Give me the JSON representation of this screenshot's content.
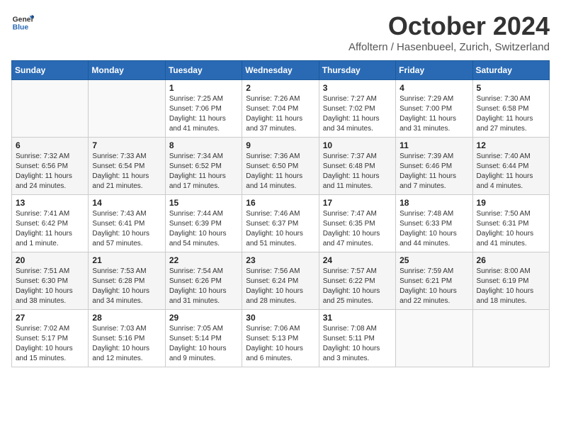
{
  "header": {
    "logo_general": "General",
    "logo_blue": "Blue",
    "title": "October 2024",
    "subtitle": "Affoltern / Hasenbueel, Zurich, Switzerland"
  },
  "weekdays": [
    "Sunday",
    "Monday",
    "Tuesday",
    "Wednesday",
    "Thursday",
    "Friday",
    "Saturday"
  ],
  "weeks": [
    [
      {
        "day": "",
        "sunrise": "",
        "sunset": "",
        "daylight": ""
      },
      {
        "day": "",
        "sunrise": "",
        "sunset": "",
        "daylight": ""
      },
      {
        "day": "1",
        "sunrise": "Sunrise: 7:25 AM",
        "sunset": "Sunset: 7:06 PM",
        "daylight": "Daylight: 11 hours and 41 minutes."
      },
      {
        "day": "2",
        "sunrise": "Sunrise: 7:26 AM",
        "sunset": "Sunset: 7:04 PM",
        "daylight": "Daylight: 11 hours and 37 minutes."
      },
      {
        "day": "3",
        "sunrise": "Sunrise: 7:27 AM",
        "sunset": "Sunset: 7:02 PM",
        "daylight": "Daylight: 11 hours and 34 minutes."
      },
      {
        "day": "4",
        "sunrise": "Sunrise: 7:29 AM",
        "sunset": "Sunset: 7:00 PM",
        "daylight": "Daylight: 11 hours and 31 minutes."
      },
      {
        "day": "5",
        "sunrise": "Sunrise: 7:30 AM",
        "sunset": "Sunset: 6:58 PM",
        "daylight": "Daylight: 11 hours and 27 minutes."
      }
    ],
    [
      {
        "day": "6",
        "sunrise": "Sunrise: 7:32 AM",
        "sunset": "Sunset: 6:56 PM",
        "daylight": "Daylight: 11 hours and 24 minutes."
      },
      {
        "day": "7",
        "sunrise": "Sunrise: 7:33 AM",
        "sunset": "Sunset: 6:54 PM",
        "daylight": "Daylight: 11 hours and 21 minutes."
      },
      {
        "day": "8",
        "sunrise": "Sunrise: 7:34 AM",
        "sunset": "Sunset: 6:52 PM",
        "daylight": "Daylight: 11 hours and 17 minutes."
      },
      {
        "day": "9",
        "sunrise": "Sunrise: 7:36 AM",
        "sunset": "Sunset: 6:50 PM",
        "daylight": "Daylight: 11 hours and 14 minutes."
      },
      {
        "day": "10",
        "sunrise": "Sunrise: 7:37 AM",
        "sunset": "Sunset: 6:48 PM",
        "daylight": "Daylight: 11 hours and 11 minutes."
      },
      {
        "day": "11",
        "sunrise": "Sunrise: 7:39 AM",
        "sunset": "Sunset: 6:46 PM",
        "daylight": "Daylight: 11 hours and 7 minutes."
      },
      {
        "day": "12",
        "sunrise": "Sunrise: 7:40 AM",
        "sunset": "Sunset: 6:44 PM",
        "daylight": "Daylight: 11 hours and 4 minutes."
      }
    ],
    [
      {
        "day": "13",
        "sunrise": "Sunrise: 7:41 AM",
        "sunset": "Sunset: 6:42 PM",
        "daylight": "Daylight: 11 hours and 1 minute."
      },
      {
        "day": "14",
        "sunrise": "Sunrise: 7:43 AM",
        "sunset": "Sunset: 6:41 PM",
        "daylight": "Daylight: 10 hours and 57 minutes."
      },
      {
        "day": "15",
        "sunrise": "Sunrise: 7:44 AM",
        "sunset": "Sunset: 6:39 PM",
        "daylight": "Daylight: 10 hours and 54 minutes."
      },
      {
        "day": "16",
        "sunrise": "Sunrise: 7:46 AM",
        "sunset": "Sunset: 6:37 PM",
        "daylight": "Daylight: 10 hours and 51 minutes."
      },
      {
        "day": "17",
        "sunrise": "Sunrise: 7:47 AM",
        "sunset": "Sunset: 6:35 PM",
        "daylight": "Daylight: 10 hours and 47 minutes."
      },
      {
        "day": "18",
        "sunrise": "Sunrise: 7:48 AM",
        "sunset": "Sunset: 6:33 PM",
        "daylight": "Daylight: 10 hours and 44 minutes."
      },
      {
        "day": "19",
        "sunrise": "Sunrise: 7:50 AM",
        "sunset": "Sunset: 6:31 PM",
        "daylight": "Daylight: 10 hours and 41 minutes."
      }
    ],
    [
      {
        "day": "20",
        "sunrise": "Sunrise: 7:51 AM",
        "sunset": "Sunset: 6:30 PM",
        "daylight": "Daylight: 10 hours and 38 minutes."
      },
      {
        "day": "21",
        "sunrise": "Sunrise: 7:53 AM",
        "sunset": "Sunset: 6:28 PM",
        "daylight": "Daylight: 10 hours and 34 minutes."
      },
      {
        "day": "22",
        "sunrise": "Sunrise: 7:54 AM",
        "sunset": "Sunset: 6:26 PM",
        "daylight": "Daylight: 10 hours and 31 minutes."
      },
      {
        "day": "23",
        "sunrise": "Sunrise: 7:56 AM",
        "sunset": "Sunset: 6:24 PM",
        "daylight": "Daylight: 10 hours and 28 minutes."
      },
      {
        "day": "24",
        "sunrise": "Sunrise: 7:57 AM",
        "sunset": "Sunset: 6:22 PM",
        "daylight": "Daylight: 10 hours and 25 minutes."
      },
      {
        "day": "25",
        "sunrise": "Sunrise: 7:59 AM",
        "sunset": "Sunset: 6:21 PM",
        "daylight": "Daylight: 10 hours and 22 minutes."
      },
      {
        "day": "26",
        "sunrise": "Sunrise: 8:00 AM",
        "sunset": "Sunset: 6:19 PM",
        "daylight": "Daylight: 10 hours and 18 minutes."
      }
    ],
    [
      {
        "day": "27",
        "sunrise": "Sunrise: 7:02 AM",
        "sunset": "Sunset: 5:17 PM",
        "daylight": "Daylight: 10 hours and 15 minutes."
      },
      {
        "day": "28",
        "sunrise": "Sunrise: 7:03 AM",
        "sunset": "Sunset: 5:16 PM",
        "daylight": "Daylight: 10 hours and 12 minutes."
      },
      {
        "day": "29",
        "sunrise": "Sunrise: 7:05 AM",
        "sunset": "Sunset: 5:14 PM",
        "daylight": "Daylight: 10 hours and 9 minutes."
      },
      {
        "day": "30",
        "sunrise": "Sunrise: 7:06 AM",
        "sunset": "Sunset: 5:13 PM",
        "daylight": "Daylight: 10 hours and 6 minutes."
      },
      {
        "day": "31",
        "sunrise": "Sunrise: 7:08 AM",
        "sunset": "Sunset: 5:11 PM",
        "daylight": "Daylight: 10 hours and 3 minutes."
      },
      {
        "day": "",
        "sunrise": "",
        "sunset": "",
        "daylight": ""
      },
      {
        "day": "",
        "sunrise": "",
        "sunset": "",
        "daylight": ""
      }
    ]
  ]
}
